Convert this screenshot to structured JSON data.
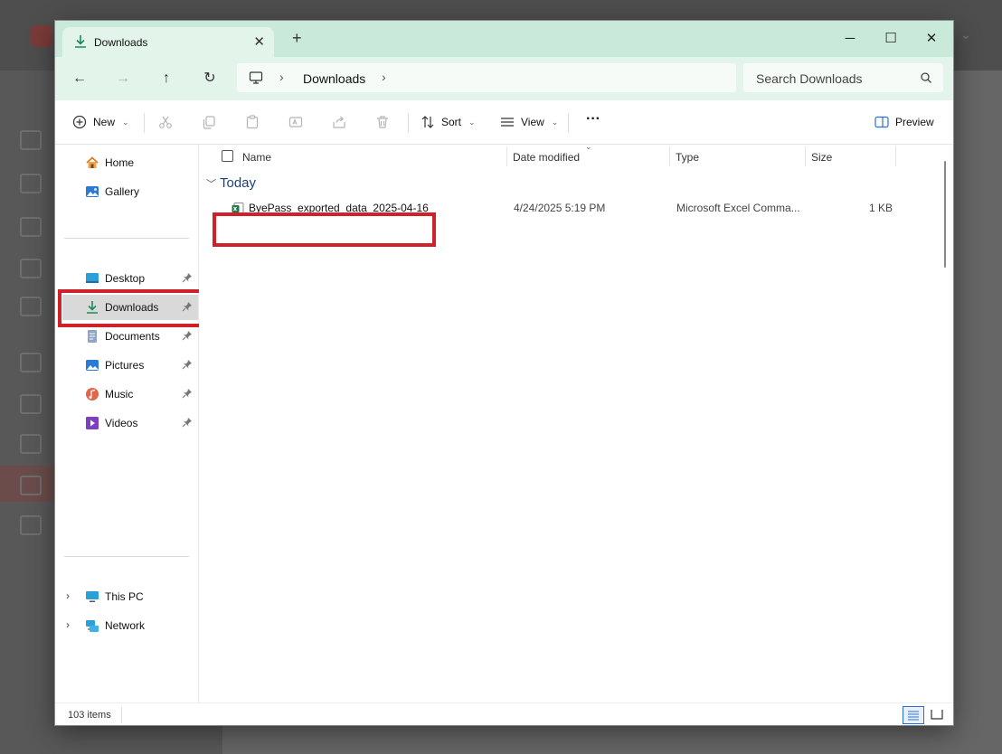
{
  "window": {
    "tab_title": "Downloads",
    "new_tab_symbol": "+",
    "close_tab_symbol": "✕",
    "minimize_symbol": "─",
    "maximize_symbol": "☐",
    "close_symbol": "✕"
  },
  "address": {
    "crumbs": [
      "Downloads"
    ],
    "search_placeholder": "Search Downloads"
  },
  "toolbar": {
    "new_label": "New",
    "sort_label": "Sort",
    "view_label": "View",
    "more_label": "···",
    "preview_label": "Preview",
    "icons": [
      "cut-icon",
      "copy-icon",
      "paste-icon",
      "rename-icon",
      "share-icon",
      "delete-icon"
    ]
  },
  "sidebar": {
    "top": [
      {
        "label": "Home",
        "icon": "home-icon"
      },
      {
        "label": "Gallery",
        "icon": "gallery-icon"
      }
    ],
    "quick": [
      {
        "label": "Desktop",
        "icon": "desktop-icon"
      },
      {
        "label": "Downloads",
        "icon": "downloads-icon"
      },
      {
        "label": "Documents",
        "icon": "documents-icon"
      },
      {
        "label": "Pictures",
        "icon": "pictures-icon"
      },
      {
        "label": "Music",
        "icon": "music-icon"
      },
      {
        "label": "Videos",
        "icon": "videos-icon"
      }
    ],
    "bottom": [
      {
        "label": "This PC",
        "icon": "pc-icon"
      },
      {
        "label": "Network",
        "icon": "network-icon"
      }
    ],
    "selected": "Downloads"
  },
  "columns": {
    "name": "Name",
    "date": "Date modified",
    "type": "Type",
    "size": "Size"
  },
  "group": {
    "label": "Today"
  },
  "files": [
    {
      "name": "ByePass_exported_data_2025-04-16",
      "date": "4/24/2025 5:19 PM",
      "type": "Microsoft Excel Comma...",
      "size": "1 KB",
      "icon": "excel-csv-icon"
    }
  ],
  "status": {
    "count": "103 items"
  },
  "colors": {
    "titlebar": "#c9eadb",
    "navbar": "#e3f4eb",
    "highlight": "#d0202a",
    "accent": "#2a6fd6"
  }
}
